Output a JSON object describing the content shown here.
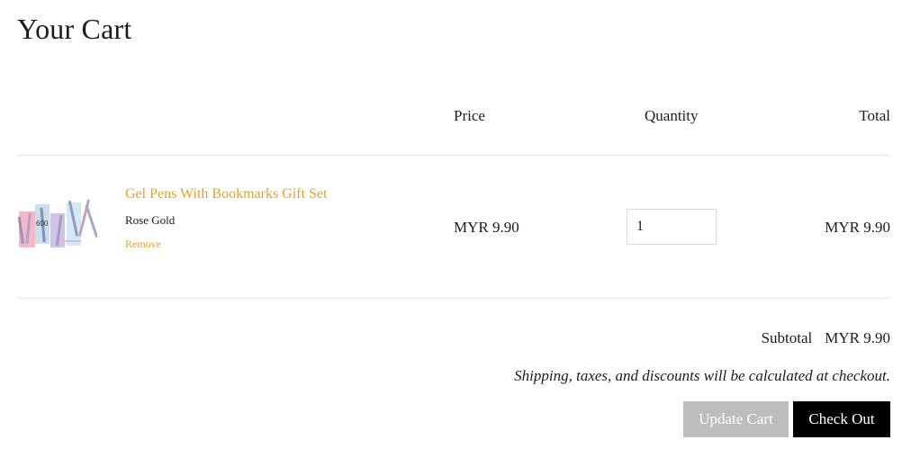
{
  "page": {
    "title": "Your Cart"
  },
  "table": {
    "headers": {
      "price": "Price",
      "quantity": "Quantity",
      "total": "Total"
    }
  },
  "cart": {
    "items": [
      {
        "name": "Gel Pens With Bookmarks Gift Set",
        "variant": "Rose Gold",
        "remove_label": "Remove",
        "price": "MYR 9.90",
        "quantity": "1",
        "line_total": "MYR 9.90",
        "thumbnail_icon": "product-thumbnail",
        "thumbnail_text": "600"
      }
    ]
  },
  "summary": {
    "subtotal_label": "Subtotal",
    "subtotal_value": "MYR 9.90",
    "note": "Shipping, taxes, and discounts will be calculated at checkout."
  },
  "actions": {
    "update_label": "Update Cart",
    "checkout_label": "Check Out"
  },
  "colors": {
    "accent": "#e0a12e",
    "checkout_bg": "#000000",
    "update_bg": "#bdbdbd"
  }
}
